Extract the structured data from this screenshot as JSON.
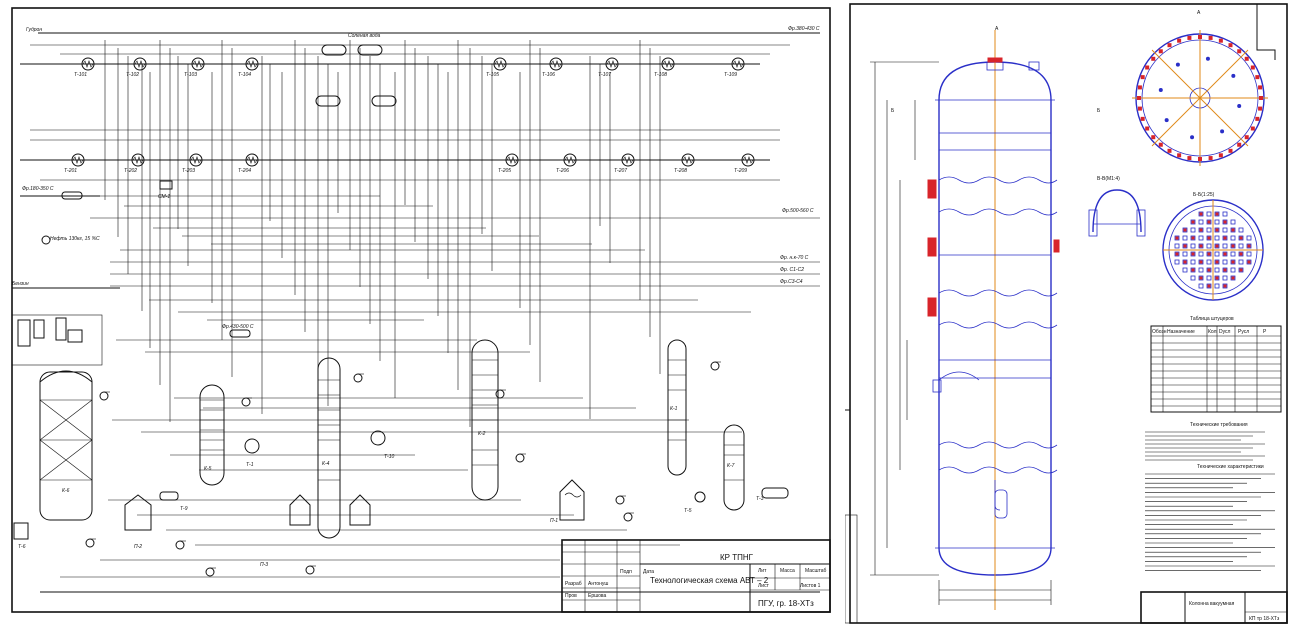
{
  "left": {
    "feed_labels": {
      "gudron": "Гудрон",
      "fr_380_430": "Фр.380-430 С",
      "fr_180_350": "Фр.180-350 С",
      "fr_500_560": "Фр.500-560 С",
      "fr_430_500": "Фр.430-500 С",
      "fr_nk70": "Фр. н.к-70 С",
      "fr_c1_c2": "Фр. С1-С2",
      "fr_c3_c4": "Фр.С3-С4",
      "benzin": "Бензин",
      "neft": "Нефть 130кг, 15 %С"
    },
    "equipment": {
      "columns": [
        "К-6",
        "К-5",
        "К-4",
        "К-2",
        "К-1",
        "К-7"
      ],
      "furnaces": [
        "П-1",
        "П-2",
        "П-3"
      ],
      "heat_exchangers_top": [
        "Т-101",
        "Т-102",
        "Т-103",
        "Т-104",
        "Т-105",
        "Т-106",
        "Т-107",
        "Т-108",
        "Т-109"
      ],
      "heat_exchangers_mid": [
        "Т-201",
        "Т-202",
        "Т-203",
        "Т-204",
        "Т-205",
        "Т-206",
        "Т-207",
        "Т-208",
        "Т-209"
      ],
      "mixer": "СМ-1",
      "t10": "Т-10",
      "t1": "Т-1",
      "t5": "Т-5",
      "t6": "Т-6",
      "t9": "Т-9",
      "t3": "Т-3",
      "salt_water": "Соленая вода"
    },
    "title_block": {
      "doc_code": "КР ТПНГ",
      "title": "Технологическая схема АВТ – 2",
      "org": "ПГУ, гр. 18-ХТз",
      "col_lit": "Лит",
      "col_mass": "Масса",
      "col_scale": "Масштаб",
      "sheet": "Лист",
      "sheets": "Листов 1",
      "developer_role": "Разраб",
      "developer": "Антонуш",
      "checker_role": "Пров",
      "checker": "Ершова",
      "sign": "Подп",
      "date": "Дата"
    }
  },
  "right": {
    "section_a": "А",
    "section_b": "Б",
    "section_bb": "В-В(М1:4)",
    "section_bb2": "Б-Б(1:25)",
    "table_title": "Таблица штуцеров",
    "table_headers": [
      "Обозн",
      "Назначение",
      "Кол",
      "Dусл",
      "Русл",
      "Р"
    ],
    "tech_req_title": "Технические требования",
    "tech_char_title": "Технические характеристики",
    "stamp_title": "Колонна вакуумная",
    "stamp_code": "КП тр 18-ХТз"
  },
  "colors": {
    "ink": "#111111",
    "blue": "#2a2fc8",
    "orange": "#e08a1a",
    "red": "#d8242a",
    "frame": "#000000"
  }
}
